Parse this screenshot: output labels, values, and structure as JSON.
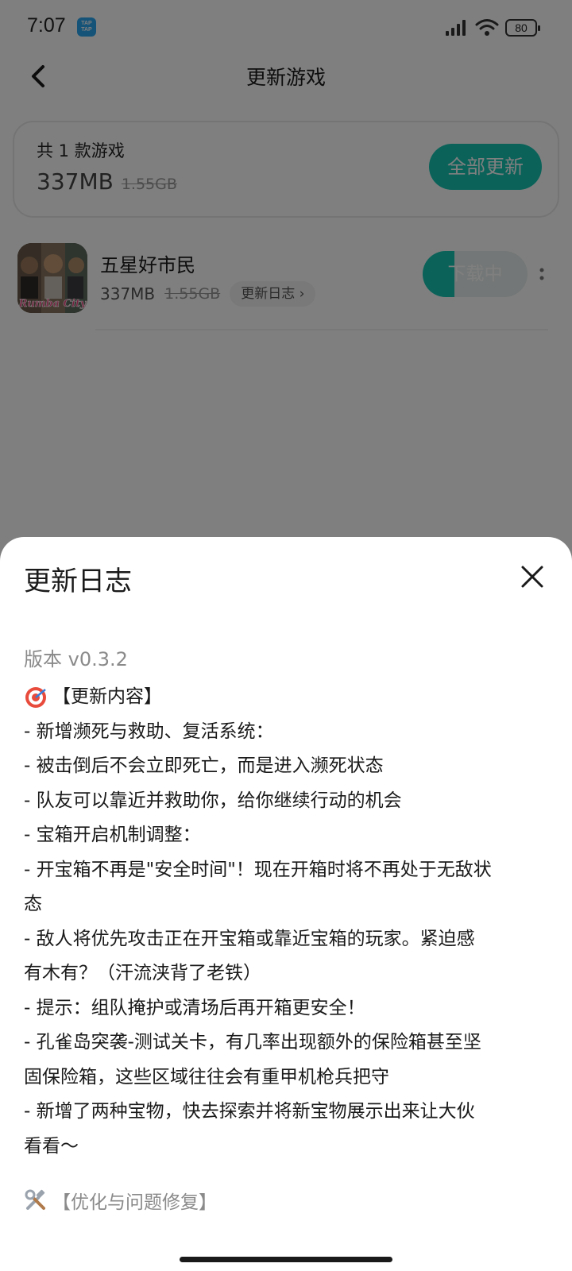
{
  "status_bar": {
    "time": "7:07",
    "app_badge": "TAP TAP",
    "battery": "80"
  },
  "header": {
    "title": "更新游戏"
  },
  "summary": {
    "count_label": "共 1 款游戏",
    "size": "337MB",
    "original_size": "1.55GB",
    "update_all_label": "全部更新"
  },
  "game": {
    "name": "五星好市民",
    "icon_text": "Rumba City",
    "size": "337MB",
    "original_size": "1.55GB",
    "changelog_label": "更新日志",
    "download_label": "下载中",
    "download_progress": 0.3
  },
  "changelog_sheet": {
    "title": "更新日志",
    "version": "版本 v0.3.2",
    "heading": "【更新内容】",
    "lines": [
      "- 新增濒死与救助、复活系统：",
      "- 被击倒后不会立即死亡，而是进入濒死状态",
      "- 队友可以靠近并救助你，给你继续行动的机会",
      "- 宝箱开启机制调整：",
      "- 开宝箱不再是\"安全时间\"！现在开箱时将不再处于无敌状",
      "态",
      "- 敌人将优先攻击正在开宝箱或靠近宝箱的玩家。紧迫感",
      "有木有？（汗流浃背了老铁）",
      "- 提示：组队掩护或清场后再开箱更安全！",
      "- 孔雀岛突袭-测试关卡，有几率出现额外的保险箱甚至坚",
      "固保险箱，这些区域往往会有重甲机枪兵把守",
      "- 新增了两种宝物，快去探索并将新宝物展示出来让大伙",
      "看看～"
    ],
    "fix_heading": "【优化与问题修复】"
  },
  "colors": {
    "accent": "#15c5b3",
    "overlay": "rgba(0,0,0,0.5)"
  }
}
